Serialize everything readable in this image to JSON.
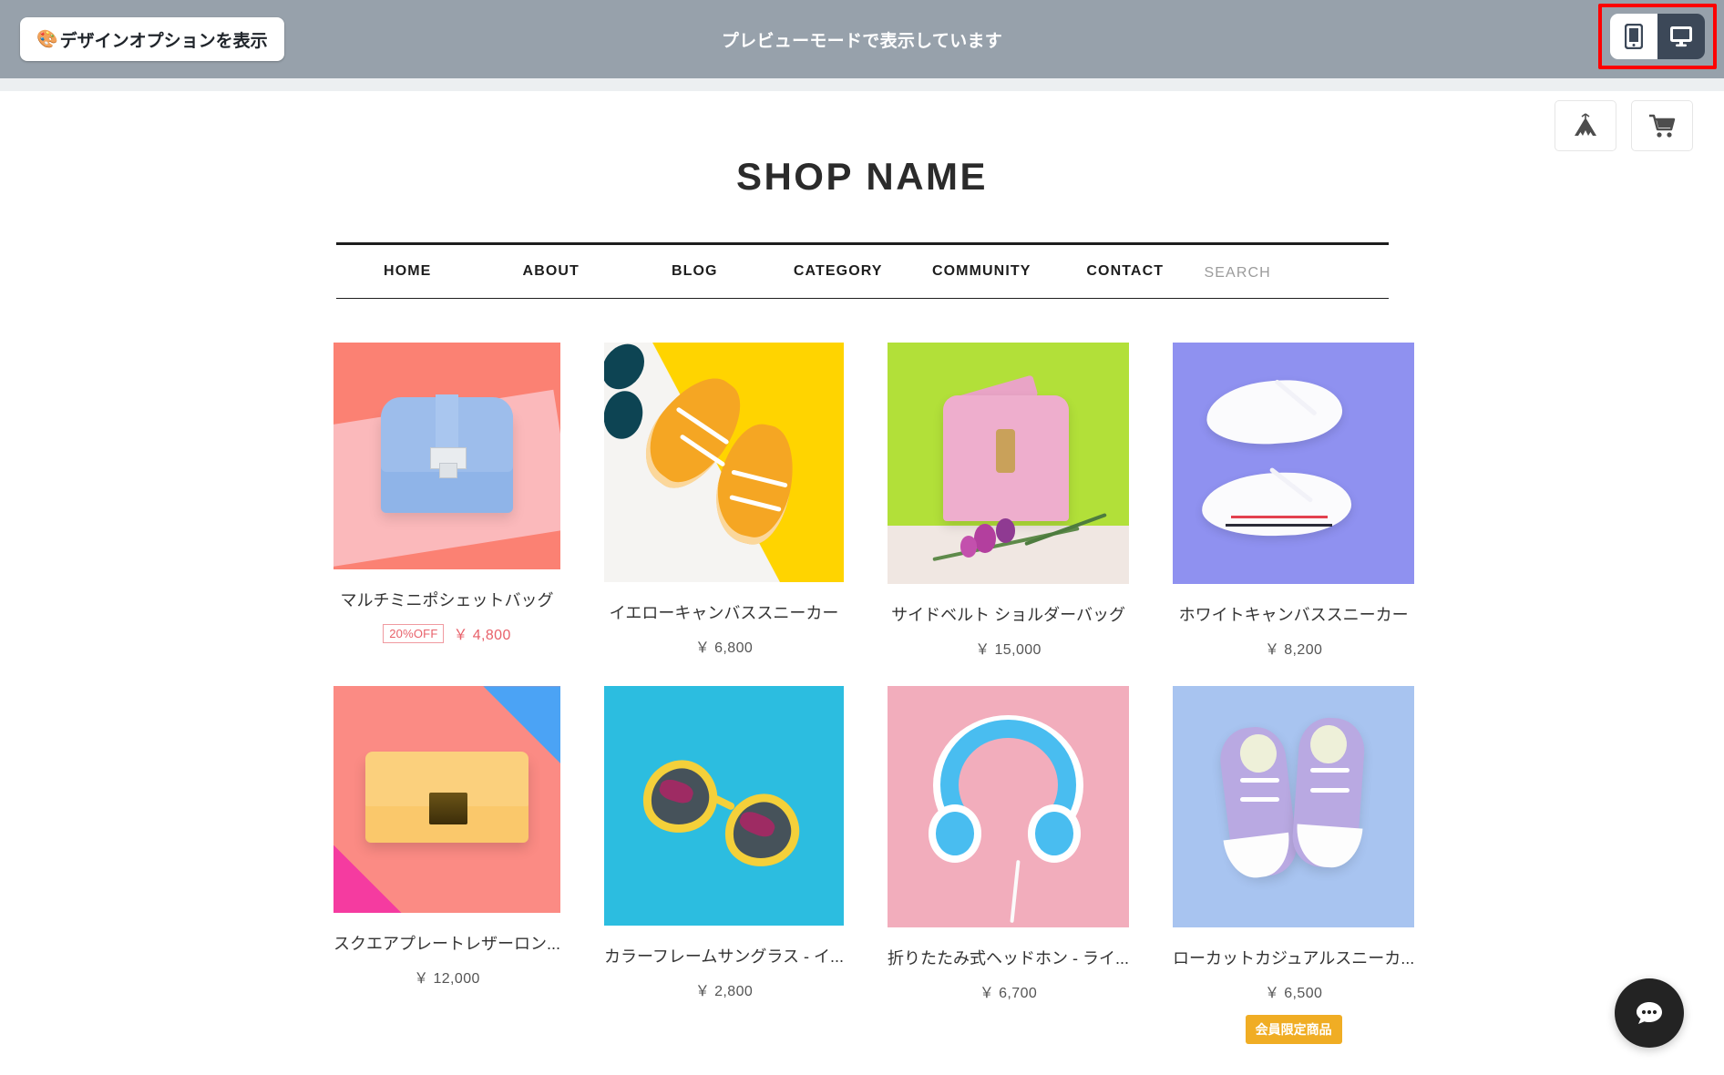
{
  "preview_bar": {
    "design_options_label": "デザインオプションを表示",
    "palette_icon": "palette-icon",
    "message": "プレビューモードで表示しています",
    "device_toggle": {
      "mobile_label": "mobile-view",
      "desktop_label": "desktop-view",
      "active": "desktop"
    },
    "highlight_color": "#ff0000",
    "bar_color": "#97a1ab"
  },
  "shop": {
    "title": "SHOP NAME",
    "header_icons": [
      {
        "name": "tent-icon",
        "label": "tent"
      },
      {
        "name": "cart-icon",
        "label": "cart"
      }
    ],
    "nav": [
      {
        "label": "HOME"
      },
      {
        "label": "ABOUT"
      },
      {
        "label": "BLOG"
      },
      {
        "label": "CATEGORY"
      },
      {
        "label": "COMMUNITY"
      },
      {
        "label": "CONTACT"
      }
    ],
    "search": {
      "placeholder": "SEARCH",
      "value": ""
    }
  },
  "products": [
    {
      "name": "マルチミニポシェットバッグ",
      "price": "￥ 4,800",
      "discount_badge": "20%OFF",
      "member_badge": "",
      "on_sale": true
    },
    {
      "name": "イエローキャンバススニーカー",
      "price": "￥ 6,800",
      "discount_badge": "",
      "member_badge": "",
      "on_sale": false
    },
    {
      "name": "サイドベルト  ショルダーバッグ",
      "price": "￥ 15,000",
      "discount_badge": "",
      "member_badge": "",
      "on_sale": false
    },
    {
      "name": "ホワイトキャンバススニーカー",
      "price": "￥ 8,200",
      "discount_badge": "",
      "member_badge": "",
      "on_sale": false
    },
    {
      "name": "スクエアプレートレザーロン...",
      "price": "￥ 12,000",
      "discount_badge": "",
      "member_badge": "",
      "on_sale": false
    },
    {
      "name": "カラーフレームサングラス - イ...",
      "price": "￥ 2,800",
      "discount_badge": "",
      "member_badge": "",
      "on_sale": false
    },
    {
      "name": "折りたたみ式ヘッドホン - ライ...",
      "price": "￥ 6,700",
      "discount_badge": "",
      "member_badge": "",
      "on_sale": false
    },
    {
      "name": "ローカットカジュアルスニーカ...",
      "price": "￥ 6,500",
      "discount_badge": "",
      "member_badge": "会員限定商品",
      "on_sale": false
    }
  ],
  "chat": {
    "icon": "chat-bubble-icon"
  },
  "colors": {
    "sale_red": "#e8616a",
    "member_orange": "#f0ad24",
    "text_dark": "#2b2b2b",
    "chat_dark": "#232323"
  }
}
